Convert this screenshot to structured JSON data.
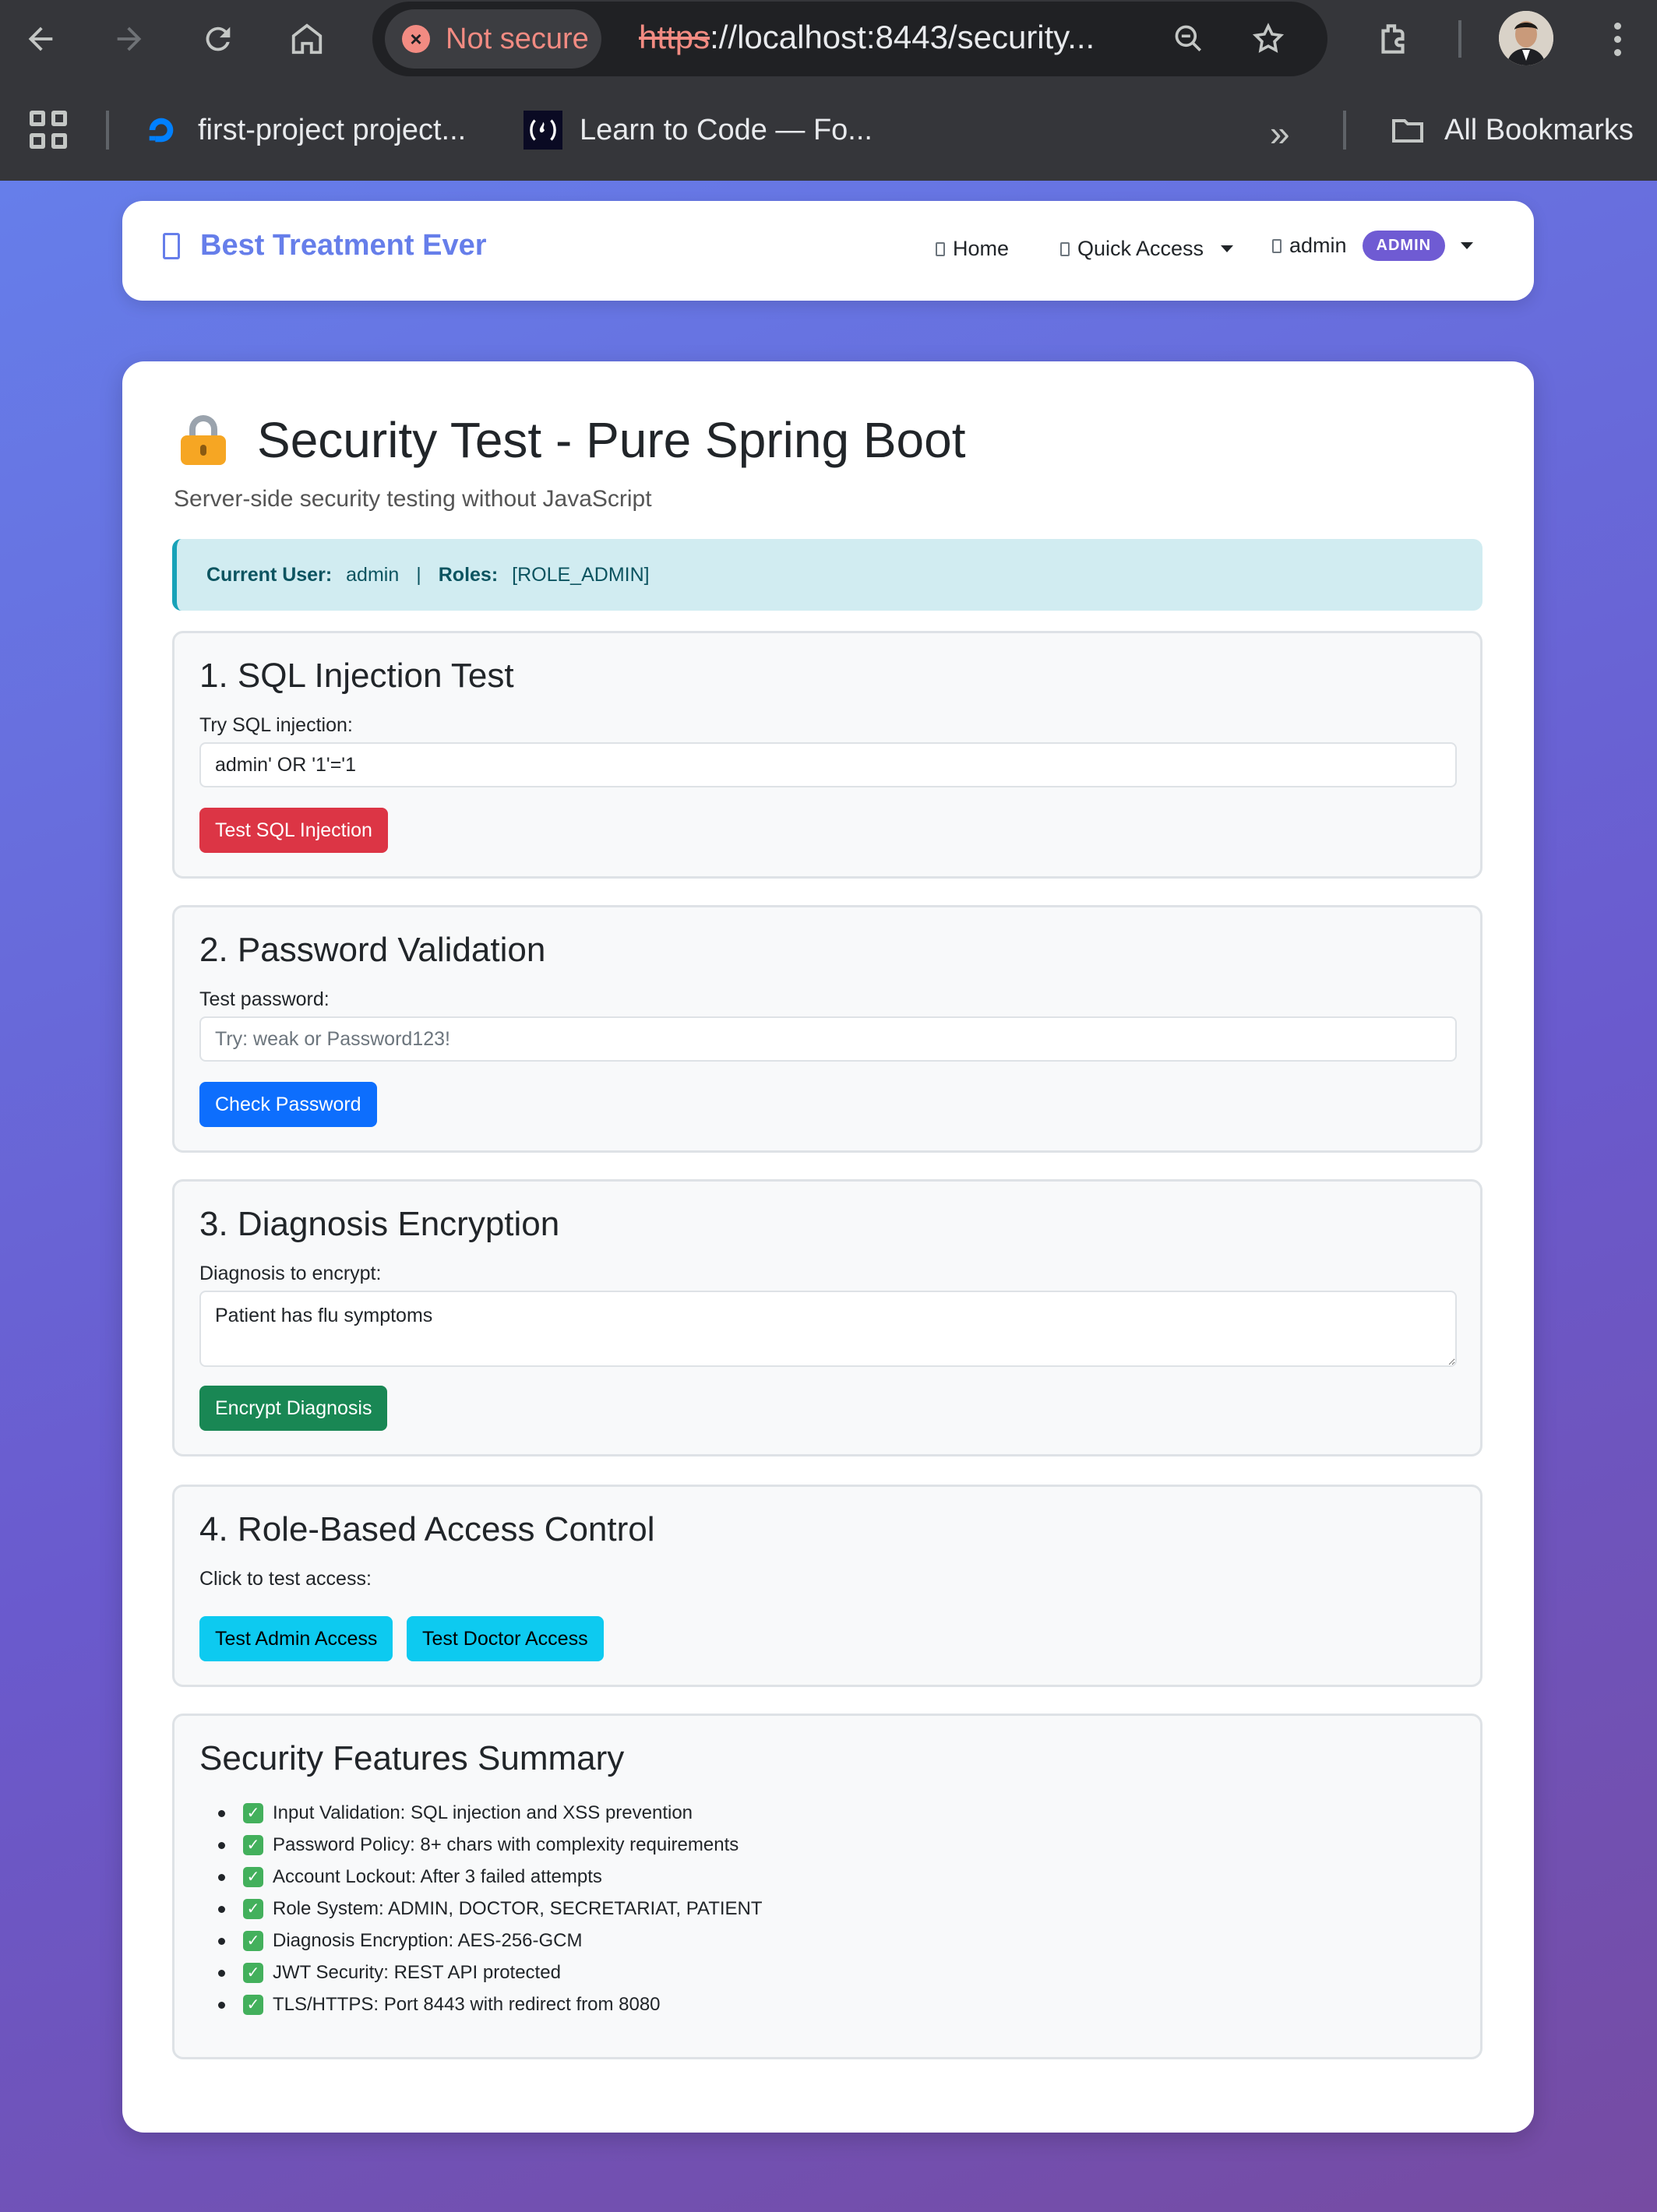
{
  "browser": {
    "security_label": "Not secure",
    "url_scheme": "https",
    "url_rest": "://localhost:8443/security...",
    "bookmarks": [
      {
        "label": "first-project project..."
      },
      {
        "label": "Learn to Code — Fo..."
      }
    ],
    "all_bookmarks_label": "All Bookmarks",
    "overflow_glyph": "»"
  },
  "navbar": {
    "brand": "Best Treatment Ever",
    "home": "Home",
    "quick_access": "Quick Access",
    "user": "admin",
    "role_badge": "ADMIN"
  },
  "header": {
    "title": "Security Test - Pure Spring Boot",
    "subtitle": "Server-side security testing without JavaScript"
  },
  "user_info": {
    "current_user_label": "Current User:",
    "current_user": "admin",
    "separator": "|",
    "roles_label": "Roles:",
    "roles": "[ROLE_ADMIN]"
  },
  "sql_test": {
    "title": "1. SQL Injection Test",
    "label": "Try SQL injection:",
    "value": "admin' OR '1'='1",
    "button": "Test SQL Injection"
  },
  "password_test": {
    "title": "2. Password Validation",
    "label": "Test password:",
    "placeholder": "Try: weak or Password123!",
    "button": "Check Password"
  },
  "encryption_test": {
    "title": "3. Diagnosis Encryption",
    "label": "Diagnosis to encrypt:",
    "value": "Patient has flu symptoms",
    "button": "Encrypt Diagnosis"
  },
  "rbac_test": {
    "title": "4. Role-Based Access Control",
    "label": "Click to test access:",
    "admin_button": "Test Admin Access",
    "doctor_button": "Test Doctor Access"
  },
  "summary": {
    "title": "Security Features Summary",
    "items": [
      "Input Validation: SQL injection and XSS prevention",
      "Password Policy: 8+ chars with complexity requirements",
      "Account Lockout: After 3 failed attempts",
      "Role System: ADMIN, DOCTOR, SECRETARIAT, PATIENT",
      "Diagnosis Encryption: AES-256-GCM",
      "JWT Security: REST API protected",
      "TLS/HTTPS: Port 8443 with redirect from 8080"
    ]
  }
}
